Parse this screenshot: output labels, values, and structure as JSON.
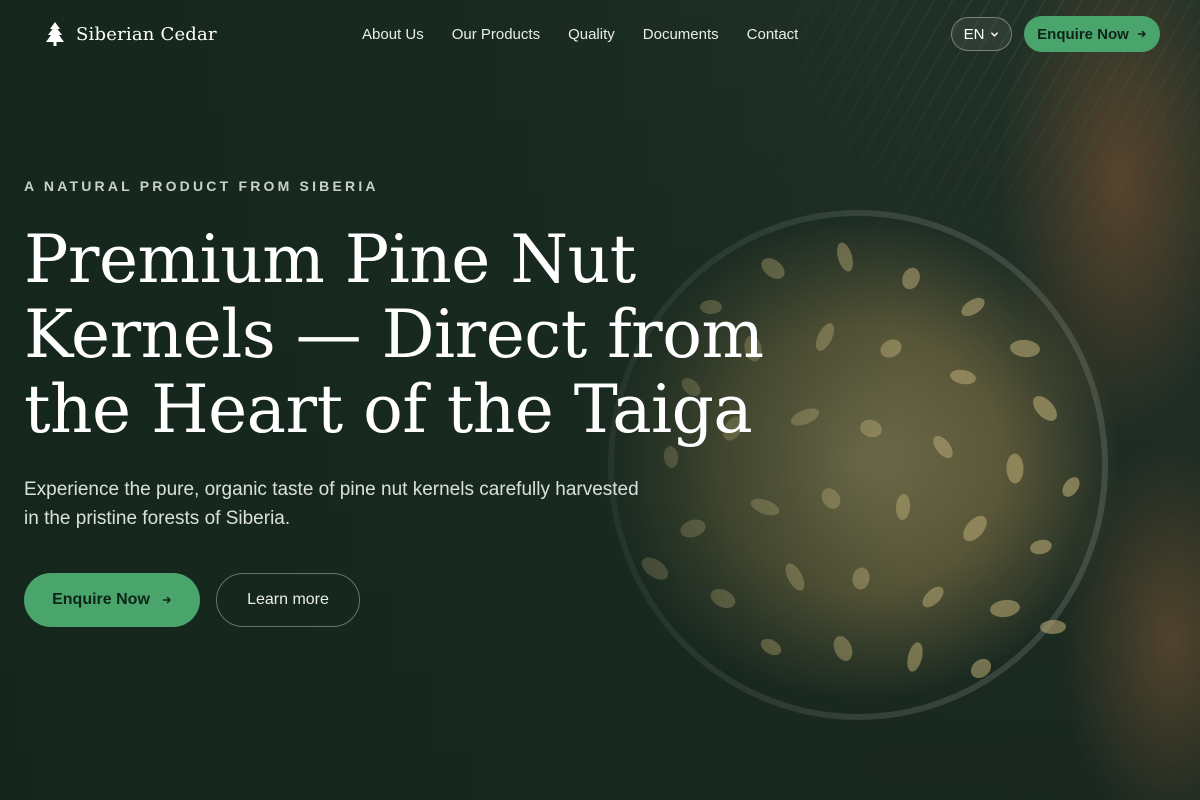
{
  "brand": {
    "name": "Siberian Cedar",
    "icon": "pine-tree-icon"
  },
  "nav": {
    "links": [
      "About Us",
      "Our Products",
      "Quality",
      "Documents",
      "Contact"
    ],
    "language": "EN",
    "cta_label": "Enquire Now"
  },
  "hero": {
    "eyebrow": "A NATURAL PRODUCT FROM SIBERIA",
    "headline_lines": [
      "Premium Pine Nut",
      "Kernels — Direct from",
      "the Heart of the Taiga"
    ],
    "subtitle": "Experience the pure, organic taste of pine nut kernels carefully harvested in the pristine forests of Siberia.",
    "primary_cta": "Enquire Now",
    "secondary_cta": "Learn more"
  },
  "colors": {
    "accent": "#4aa56d",
    "background": "#1f2d25"
  }
}
